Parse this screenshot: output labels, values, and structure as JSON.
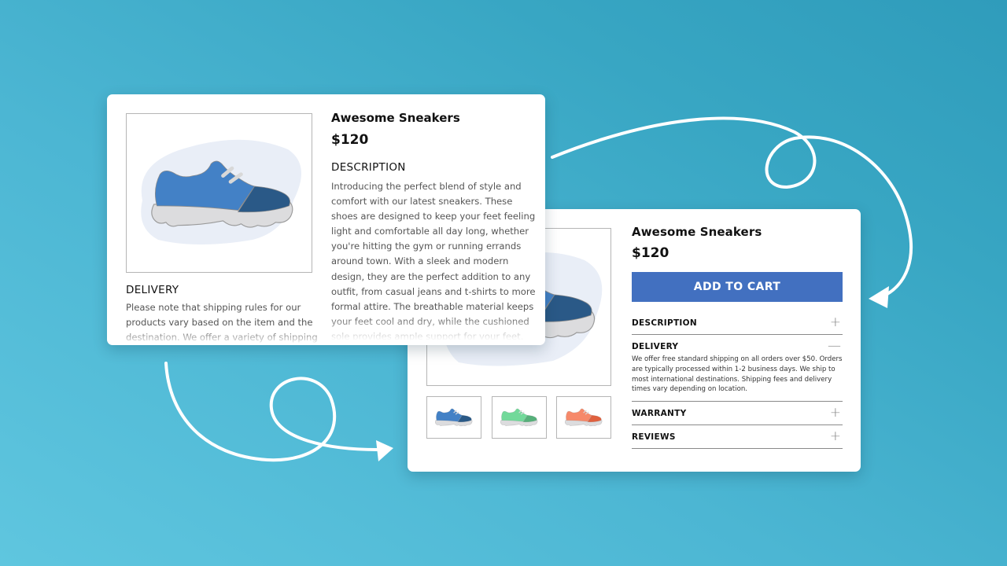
{
  "background": {
    "gradient_from": "#5fc6df",
    "gradient_to": "#2f9cbb"
  },
  "card_before": {
    "product_image": {
      "alt": "blue-sneaker",
      "colors": {
        "upper": "#4381c6",
        "toe": "#2a5987",
        "sole": "#dcdcde",
        "blob": "#e9eef7"
      }
    },
    "title": "Awesome Sneakers",
    "price": "$120",
    "description_heading": "DESCRIPTION",
    "description_text": "Introducing the perfect blend of style and comfort with our latest sneakers. These shoes are designed to keep your feet feeling light and comfortable all day long, whether you're hitting the gym or running errands around town. With a sleek and modern design, they are the perfect addition to any outfit, from casual jeans and t-shirts to more formal attire. The breathable material keeps your feet cool and dry, while the cushioned sole provides ample support for your feet.",
    "delivery_heading": "DELIVERY",
    "delivery_text": "Please note that shipping rules for our products vary based on the item and the destination. We offer a variety of shipping options."
  },
  "card_after": {
    "title": "Awesome Sneakers",
    "price": "$120",
    "add_to_cart_label": "ADD TO CART",
    "button_color": "#4270c0",
    "thumbnails": [
      {
        "name": "blue",
        "upper": "#4381c6",
        "toe": "#2a5987"
      },
      {
        "name": "green",
        "upper": "#72d99a",
        "toe": "#56b07a"
      },
      {
        "name": "orange",
        "upper": "#f6896a",
        "toe": "#e0603e"
      }
    ],
    "accordion": [
      {
        "label": "DESCRIPTION",
        "expanded": false,
        "toggle": "+"
      },
      {
        "label": "DELIVERY",
        "expanded": true,
        "toggle": "—",
        "body": "We offer free standard shipping on all orders over $50. Orders are typically processed within 1-2 business days. We ship to most international destinations. Shipping fees and delivery times vary depending on location."
      },
      {
        "label": "WARRANTY",
        "expanded": false,
        "toggle": "+"
      },
      {
        "label": "REVIEWS",
        "expanded": false,
        "toggle": "+"
      }
    ]
  },
  "decor": {
    "arrow_color": "#ffffff"
  }
}
